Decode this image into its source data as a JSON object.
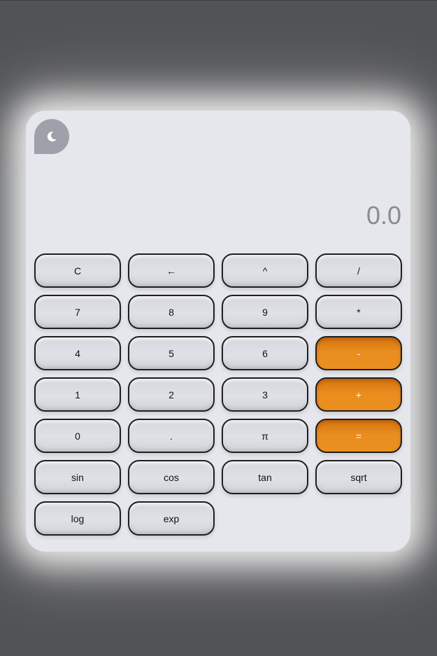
{
  "display": {
    "value": "0.0"
  },
  "theme_toggle": {
    "icon": "moon-icon"
  },
  "colors": {
    "page_background": "#525355",
    "calculator_background": "#e6e7ec",
    "operator_key": "#e98d1f",
    "display_text": "#8a8b8f"
  },
  "keys": [
    {
      "label": "C"
    },
    {
      "label": "←"
    },
    {
      "label": "^"
    },
    {
      "label": "/"
    },
    {
      "label": "7"
    },
    {
      "label": "8"
    },
    {
      "label": "9"
    },
    {
      "label": "*"
    },
    {
      "label": "4"
    },
    {
      "label": "5"
    },
    {
      "label": "6"
    },
    {
      "label": "-"
    },
    {
      "label": "1"
    },
    {
      "label": "2"
    },
    {
      "label": "3"
    },
    {
      "label": "+"
    },
    {
      "label": "0"
    },
    {
      "label": "."
    },
    {
      "label": "π"
    },
    {
      "label": "="
    },
    {
      "label": "sin"
    },
    {
      "label": "cos"
    },
    {
      "label": "tan"
    },
    {
      "label": "sqrt"
    },
    {
      "label": "log"
    },
    {
      "label": "exp"
    }
  ]
}
